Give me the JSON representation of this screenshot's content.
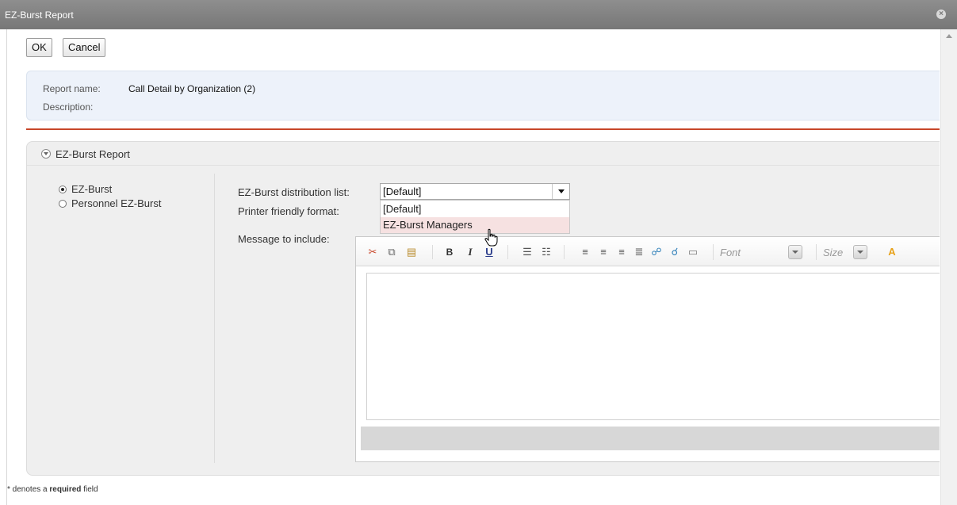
{
  "window": {
    "title": "EZ-Burst Report",
    "close_label": "×"
  },
  "toolbar": {
    "ok_label": "OK",
    "cancel_label": "Cancel"
  },
  "report": {
    "name_label": "Report name:",
    "name_value": "Call Detail by Organization (2)",
    "description_label": "Description:",
    "description_value": ""
  },
  "section": {
    "title": "EZ-Burst Report",
    "options": [
      {
        "label": "EZ-Burst",
        "checked": true
      },
      {
        "label": "Personnel EZ-Burst",
        "checked": false
      }
    ]
  },
  "form": {
    "distribution_label": "EZ-Burst distribution list:",
    "distribution_value": "[Default]",
    "distribution_options": [
      "[Default]",
      "EZ-Burst Managers"
    ],
    "hovered_option": "EZ-Burst Managers",
    "printer_label": "Printer friendly format:",
    "message_label": "Message to include:"
  },
  "editor": {
    "bold": "B",
    "italic": "I",
    "underline": "U",
    "font_placeholder": "Font",
    "size_placeholder": "Size",
    "icons": [
      "cut-icon",
      "copy-icon",
      "paste-icon",
      "bold-icon",
      "italic-icon",
      "underline-icon",
      "ordered-list-icon",
      "unordered-list-icon",
      "align-left-icon",
      "align-center-icon",
      "align-right-icon",
      "justify-icon",
      "link-icon",
      "unlink-icon",
      "horizontal-rule-icon",
      "font-color-icon"
    ]
  },
  "footer": {
    "note_prefix": "* denotes a",
    "note_bold": "required",
    "note_suffix": "field"
  },
  "colors": {
    "accent_divider": "#c8472a",
    "info_bg": "#edf2fa",
    "hover_row": "#f6e1e1"
  }
}
